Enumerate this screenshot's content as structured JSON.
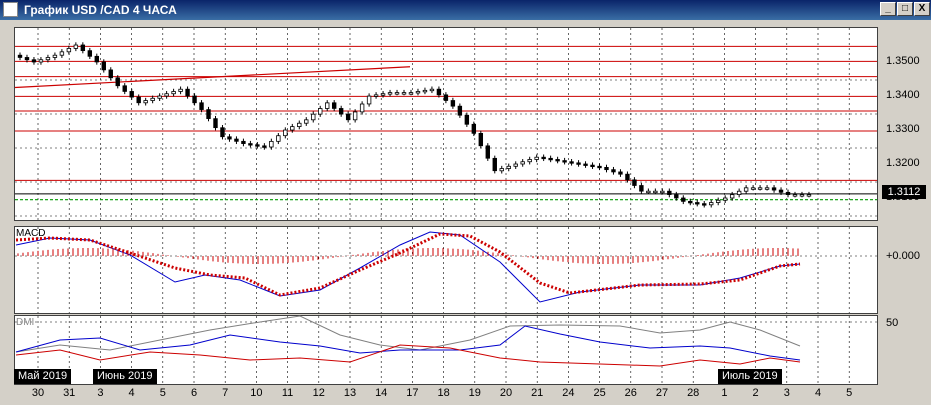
{
  "window": {
    "title": "График USD /CAD  4 ЧАСА",
    "btn_min": "_",
    "btn_max": "□",
    "btn_close": "X"
  },
  "colors": {
    "candle": "#000000",
    "resistance": "#cc0000",
    "support": "#009900",
    "trend": "#cc0000",
    "macd_line": "#0000cc",
    "signal": "#cc0000",
    "dmi_plus": "#0000cc",
    "dmi_minus": "#cc0000",
    "adx": "#808080"
  },
  "price_panel": {
    "current_price": "1.3112",
    "y_ticks": [
      {
        "value": 1.35,
        "label": "1.3500"
      },
      {
        "value": 1.34,
        "label": "1.3400"
      },
      {
        "value": 1.33,
        "label": "1.3300"
      },
      {
        "value": 1.32,
        "label": "1.3200"
      },
      {
        "value": 1.31,
        "label": "1.3100"
      }
    ],
    "resistance_levels": [
      1.3546,
      1.3502,
      1.3457,
      1.3399,
      1.3356,
      1.3297,
      1.3152
    ],
    "support_level": 1.3095,
    "price_line": 1.3112,
    "trendline": [
      {
        "x": 0,
        "y": 1.3425
      },
      {
        "x": 60,
        "y": 1.3486
      }
    ]
  },
  "macd_panel": {
    "label": "MACD",
    "zero_label": "+0.000"
  },
  "dmi_panel": {
    "label": "DMI",
    "level_label": "50"
  },
  "x_axis": {
    "labels": [
      "30",
      "31",
      "3",
      "4",
      "5",
      "6",
      "7",
      "10",
      "11",
      "12",
      "13",
      "14",
      "17",
      "18",
      "19",
      "20",
      "21",
      "24",
      "25",
      "26",
      "27",
      "28",
      "1",
      "2",
      "3",
      "4",
      "5"
    ],
    "month_markers": [
      {
        "label": "Май 2019",
        "index": 0
      },
      {
        "label": "Июнь 2019",
        "index": 2
      },
      {
        "label": "Июль 2019",
        "index": 22
      }
    ]
  },
  "chart_data": {
    "type": "candlestick",
    "title": "График USD /CAD  4 ЧАСА",
    "x_label_days": [
      "30",
      "31",
      "3",
      "4",
      "5",
      "6",
      "7",
      "10",
      "11",
      "12",
      "13",
      "14",
      "17",
      "18",
      "19",
      "20",
      "21",
      "24",
      "25",
      "26",
      "27",
      "28",
      "1",
      "2",
      "3"
    ],
    "close_approx": [
      1.35,
      1.352,
      1.355,
      1.35,
      1.343,
      1.338,
      1.34,
      1.342,
      1.336,
      1.328,
      1.326,
      1.325,
      1.33,
      1.333,
      1.338,
      1.333,
      1.34,
      1.341,
      1.341,
      1.342,
      1.337,
      1.329,
      1.318,
      1.32,
      1.322,
      1.321,
      1.32,
      1.319,
      1.317,
      1.312,
      1.312,
      1.309,
      1.308,
      1.31,
      1.313,
      1.313,
      1.311,
      1.311
    ],
    "ylim": [
      1.306,
      1.358
    ],
    "indicators": [
      "MACD",
      "DMI"
    ]
  }
}
